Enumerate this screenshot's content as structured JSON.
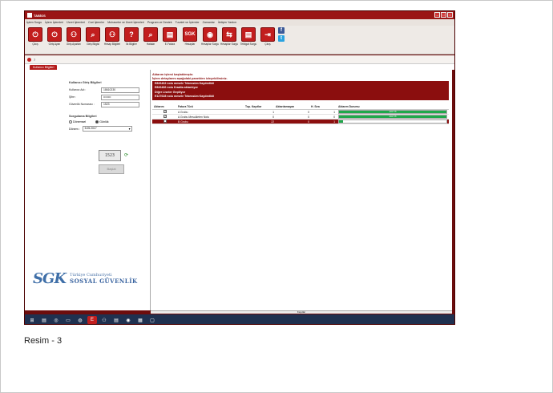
{
  "window": {
    "title": "TABİOS"
  },
  "menu": [
    "İşlem Sorgu",
    "İşlem İşlemleri",
    "Ücret İşlemleri",
    "Cari İşlemler",
    "Muhasebe ve Ücret İşlemleri",
    "Program ve Destek",
    "Tuvalet ve İşlemler",
    "Zamanlar",
    "İletişim Yardım"
  ],
  "toolbar": [
    {
      "icon": "power-icon",
      "glyph": "⏻",
      "label": "Çıkış"
    },
    {
      "icon": "power-icon",
      "glyph": "⏻",
      "label": "Giriş Ayarı"
    },
    {
      "icon": "users-icon",
      "glyph": "⚇",
      "label": "Giriş Ayarları"
    },
    {
      "icon": "search-icon",
      "glyph": "⌕",
      "label": "Giriş Bilgisi"
    },
    {
      "icon": "users-icon",
      "glyph": "⚇",
      "label": "Hesap Bilgileri"
    },
    {
      "icon": "help-icon",
      "glyph": "?",
      "label": "İlk Bilgiler"
    },
    {
      "icon": "search-icon",
      "glyph": "⌕",
      "label": "Hatalar"
    },
    {
      "icon": "document-icon",
      "glyph": "▤",
      "label": "E-Fatura"
    },
    {
      "icon": "sgk-icon",
      "glyph": "SGK",
      "label": "Hesaplar"
    },
    {
      "icon": "disk-icon",
      "glyph": "◉",
      "label": "Hesaplar Sorgu"
    },
    {
      "icon": "transfer-icon",
      "glyph": "⇆",
      "label": "Hesaplar Sorgu"
    },
    {
      "icon": "document-icon",
      "glyph": "▤",
      "label": "Tebligat Sorgu"
    },
    {
      "icon": "exit-icon",
      "glyph": "⇥",
      "label": "Çıkış"
    }
  ],
  "social": {
    "facebook": "f",
    "twitter": "t"
  },
  "status": {
    "count": "7"
  },
  "tab": {
    "label": "Kullanıcı Bilgileri"
  },
  "login": {
    "title": "Kullanıcı Giriş Bilgileri",
    "user_label": "Kullanıcı Adı :",
    "user_value": "18610230",
    "pass_label": "Şifre :",
    "pass_value": "••••••••",
    "security_label": "Güvenlik Numarası :",
    "security_value": "1523"
  },
  "query": {
    "title": "Sorgulama Bilgileri",
    "radio_monthly": "Dönemsel",
    "radio_daily": "Günlük",
    "period_label": "Dönem :",
    "period_value": "5.05.2017"
  },
  "captcha": {
    "code": "1523"
  },
  "login_button": {
    "label": "Başlat"
  },
  "logo": {
    "mark": "SGK",
    "line1": "Türkiye Cumhuriyeti",
    "line2": "SOSYAL GÜVENLİK"
  },
  "notice": {
    "title": "Aktarım işlemi başlatılmıştır.",
    "subtitle": "İşlem detaylarını aşağıdaki panelden izleyebilirsiniz."
  },
  "log": [
    "E826462 nolu mesele Tebessüm Kaydedildi",
    "E826466 nolu Kısalta aktarılıyor",
    "Diğer Liseler Geçiliyor",
    "E127628 nolu mesele Tebessüm Kaydedildi"
  ],
  "grid": {
    "headers": [
      "Aktarım",
      "Fatura Türü",
      "Top. Kayıtlar",
      "Aktarılamayan",
      "H. Sıra",
      "Aktarım Durumu"
    ],
    "rows": [
      {
        "check": "✓",
        "type": "A Grubu",
        "total": "1",
        "failed": "0",
        "hsira": "1",
        "progress": 100,
        "pct": "100 %",
        "selected": false
      },
      {
        "check": "✓",
        "type": "A Grubu Mesuületen Notu",
        "total": "0",
        "failed": "0",
        "hsira": "0",
        "progress": 100,
        "pct": "100 %",
        "selected": false
      },
      {
        "check": "✓",
        "type": "B Grubu",
        "total": "22",
        "failed": "0",
        "hsira": "1",
        "progress": 4,
        "pct": "4 %",
        "selected": true
      }
    ]
  },
  "bottom": {
    "label": "Kayıtlar"
  },
  "caption": "Resim - 3"
}
